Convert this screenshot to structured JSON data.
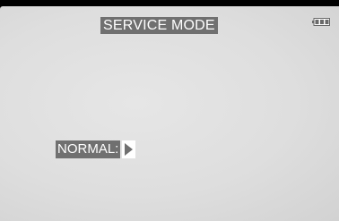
{
  "screen": {
    "title": "SERVICE MODE",
    "battery_icon": "battery-icon",
    "mode_label": "NORMAL:",
    "mode_arrow_icon": "triangle-right-icon"
  },
  "colors": {
    "label_background": "#707070",
    "label_text": "#ffffff",
    "screen_background": "#e0e0e0"
  }
}
